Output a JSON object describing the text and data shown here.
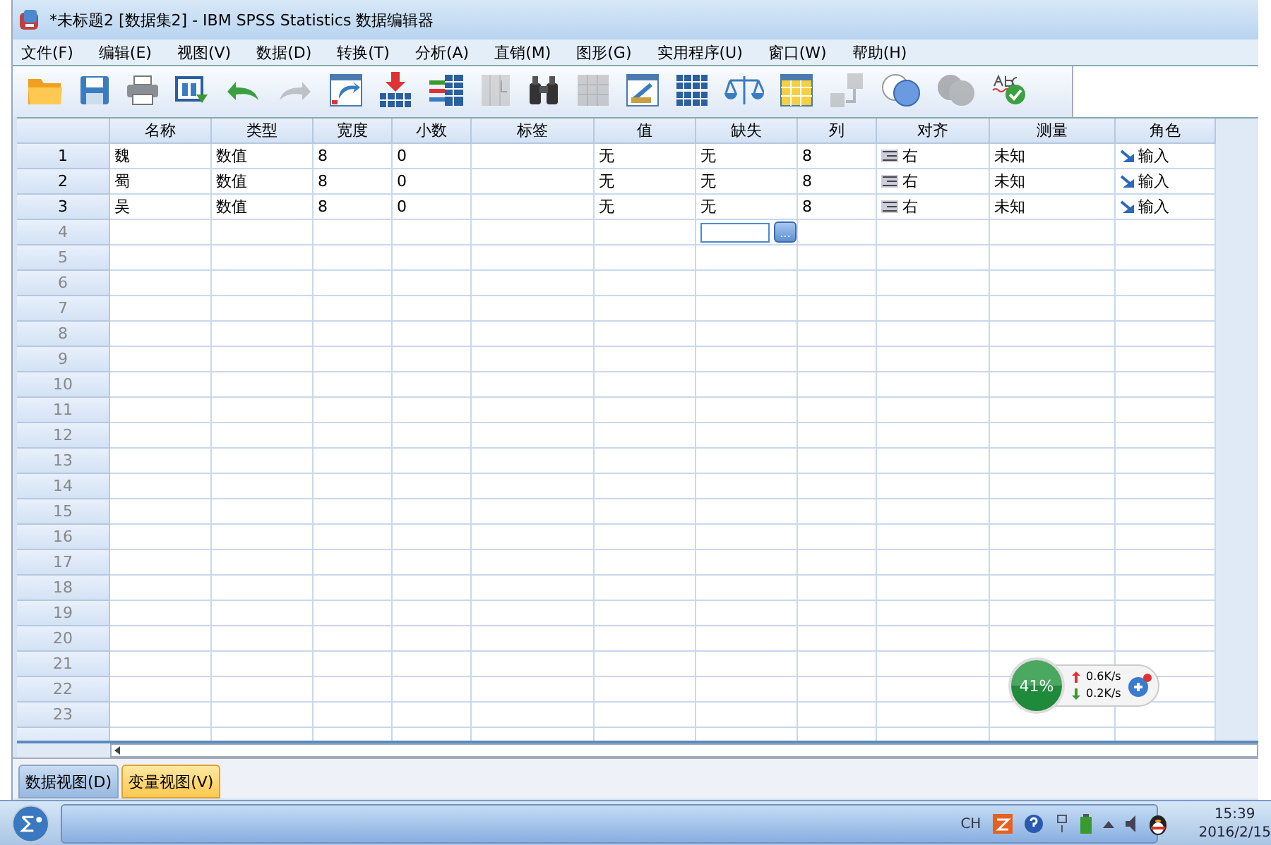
{
  "window": {
    "title": "*未标题2 [数据集2] - IBM SPSS Statistics 数据编辑器"
  },
  "menu": [
    "文件(F)",
    "编辑(E)",
    "视图(V)",
    "数据(D)",
    "转换(T)",
    "分析(A)",
    "直销(M)",
    "图形(G)",
    "实用程序(U)",
    "窗口(W)",
    "帮助(H)"
  ],
  "toolbar": [
    {
      "kind": "open",
      "disabled": false
    },
    {
      "kind": "save",
      "disabled": false
    },
    {
      "kind": "print",
      "disabled": false
    },
    {
      "kind": "recall",
      "disabled": false
    },
    {
      "kind": "undo",
      "disabled": false
    },
    {
      "kind": "redo",
      "disabled": true
    },
    {
      "kind": "goto",
      "disabled": false
    },
    {
      "kind": "insert-case",
      "disabled": false
    },
    {
      "kind": "insert-variable",
      "disabled": false
    },
    {
      "kind": "split",
      "disabled": true
    },
    {
      "kind": "find",
      "disabled": false
    },
    {
      "kind": "grid",
      "disabled": true
    },
    {
      "kind": "select",
      "disabled": false
    },
    {
      "kind": "tables",
      "disabled": false
    },
    {
      "kind": "weight",
      "disabled": false
    },
    {
      "kind": "value-labels",
      "disabled": false
    },
    {
      "kind": "labels",
      "disabled": true
    },
    {
      "kind": "sets",
      "disabled": false
    },
    {
      "kind": "sets",
      "disabled": true
    },
    {
      "kind": "spell",
      "disabled": false
    }
  ],
  "table": {
    "columns": [
      "名称",
      "类型",
      "宽度",
      "小数",
      "标签",
      "值",
      "缺失",
      "列",
      "对齐",
      "测量",
      "角色"
    ],
    "rows": [
      {
        "number": "1",
        "defined": true,
        "cells": [
          {
            "kind": "text",
            "text": "魏"
          },
          {
            "kind": "text",
            "text": "数值"
          },
          {
            "kind": "text",
            "text": "8"
          },
          {
            "kind": "text",
            "text": "0"
          },
          {
            "kind": "blank"
          },
          {
            "kind": "text",
            "text": "无"
          },
          {
            "kind": "text",
            "text": "无"
          },
          {
            "kind": "text",
            "text": "8"
          },
          {
            "kind": "align",
            "text": "右"
          },
          {
            "kind": "text",
            "text": "未知"
          },
          {
            "kind": "role",
            "text": "输入"
          }
        ]
      },
      {
        "number": "2",
        "defined": true,
        "cells": [
          {
            "kind": "text",
            "text": "蜀"
          },
          {
            "kind": "text",
            "text": "数值"
          },
          {
            "kind": "text",
            "text": "8"
          },
          {
            "kind": "text",
            "text": "0"
          },
          {
            "kind": "blank"
          },
          {
            "kind": "text",
            "text": "无"
          },
          {
            "kind": "text",
            "text": "无"
          },
          {
            "kind": "text",
            "text": "8"
          },
          {
            "kind": "align",
            "text": "右"
          },
          {
            "kind": "text",
            "text": "未知"
          },
          {
            "kind": "role",
            "text": "输入"
          }
        ]
      },
      {
        "number": "3",
        "defined": true,
        "cells": [
          {
            "kind": "text",
            "text": "吴"
          },
          {
            "kind": "text",
            "text": "数值"
          },
          {
            "kind": "text",
            "text": "8"
          },
          {
            "kind": "text",
            "text": "0"
          },
          {
            "kind": "blank"
          },
          {
            "kind": "text",
            "text": "无"
          },
          {
            "kind": "text",
            "text": "无"
          },
          {
            "kind": "text",
            "text": "8"
          },
          {
            "kind": "align",
            "text": "右"
          },
          {
            "kind": "text",
            "text": "未知"
          },
          {
            "kind": "role",
            "text": "输入"
          }
        ]
      },
      {
        "number": "4",
        "defined": false,
        "cells": [
          {
            "kind": "blank"
          },
          {
            "kind": "blank"
          },
          {
            "kind": "blank"
          },
          {
            "kind": "blank"
          },
          {
            "kind": "blank"
          },
          {
            "kind": "blank"
          },
          {
            "kind": "editor",
            "button": "..."
          },
          {
            "kind": "blank"
          },
          {
            "kind": "blank"
          },
          {
            "kind": "blank"
          },
          {
            "kind": "blank"
          }
        ]
      },
      {
        "number": "5",
        "defined": false
      },
      {
        "number": "6",
        "defined": false
      },
      {
        "number": "7",
        "defined": false
      },
      {
        "number": "8",
        "defined": false
      },
      {
        "number": "9",
        "defined": false
      },
      {
        "number": "10",
        "defined": false
      },
      {
        "number": "11",
        "defined": false
      },
      {
        "number": "12",
        "defined": false
      },
      {
        "number": "13",
        "defined": false
      },
      {
        "number": "14",
        "defined": false
      },
      {
        "number": "15",
        "defined": false
      },
      {
        "number": "16",
        "defined": false
      },
      {
        "number": "17",
        "defined": false
      },
      {
        "number": "18",
        "defined": false
      },
      {
        "number": "19",
        "defined": false
      },
      {
        "number": "20",
        "defined": false
      },
      {
        "number": "21",
        "defined": false
      },
      {
        "number": "22",
        "defined": false
      },
      {
        "number": "23",
        "defined": false
      }
    ]
  },
  "view_tabs": [
    {
      "label": "数据视图(D)",
      "selected": false
    },
    {
      "label": "变量视图(V)",
      "selected": true
    }
  ],
  "net_widget": {
    "percent": "41%",
    "upload": "0.6K/s",
    "download": "0.2K/s"
  },
  "taskbar": {
    "language": "CH",
    "time": "15:39",
    "date": "2016/2/15"
  }
}
